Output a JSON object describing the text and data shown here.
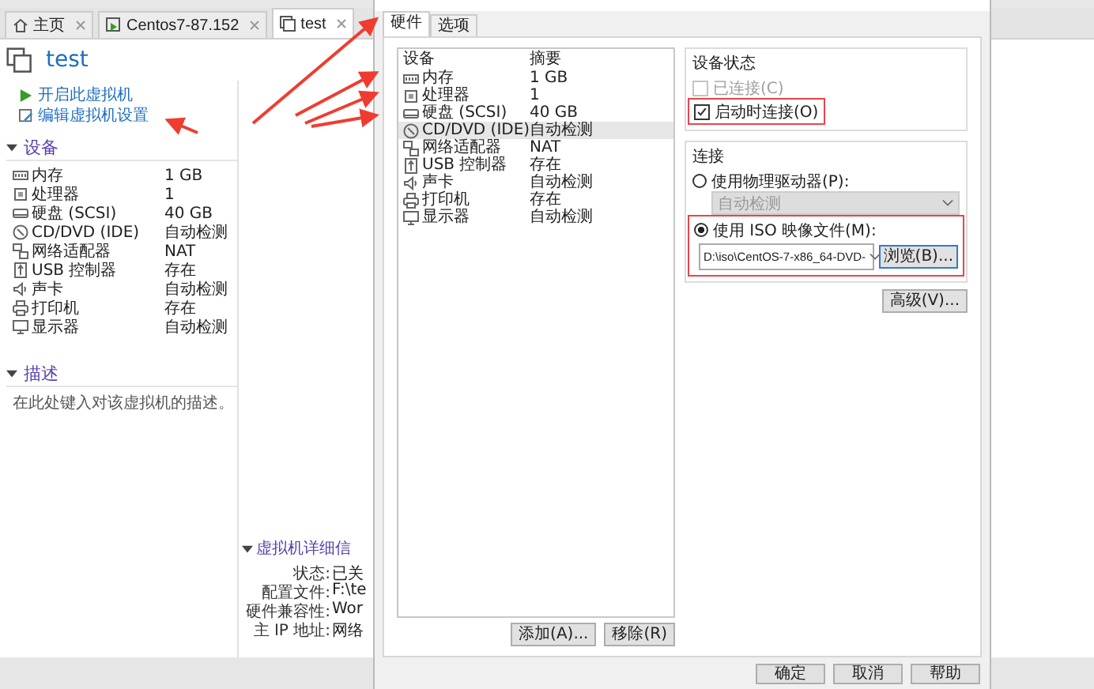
{
  "tabs": [
    {
      "label": "主页",
      "selected": false,
      "kind": "home"
    },
    {
      "label": "Centos7-87.152",
      "selected": false,
      "kind": "vm-running"
    },
    {
      "label": "test",
      "selected": true,
      "kind": "vm"
    }
  ],
  "vm": {
    "title": "test",
    "actions": [
      {
        "label": "开启此虚拟机",
        "kind": "play"
      },
      {
        "label": "编辑虚拟机设置",
        "kind": "edit"
      }
    ],
    "devices_heading": "设备",
    "devices": [
      {
        "name": "内存",
        "summary": "1 GB",
        "kind": "memory"
      },
      {
        "name": "处理器",
        "summary": "1",
        "kind": "cpu"
      },
      {
        "name": "硬盘 (SCSI)",
        "summary": "40 GB",
        "kind": "disk"
      },
      {
        "name": "CD/DVD (IDE)",
        "summary": "自动检测",
        "kind": "cd"
      },
      {
        "name": "网络适配器",
        "summary": "NAT",
        "kind": "network"
      },
      {
        "name": "USB 控制器",
        "summary": "存在",
        "kind": "usb"
      },
      {
        "name": "声卡",
        "summary": "自动检测",
        "kind": "sound"
      },
      {
        "name": "打印机",
        "summary": "存在",
        "kind": "printer"
      },
      {
        "name": "显示器",
        "summary": "自动检测",
        "kind": "display"
      }
    ],
    "description_heading": "描述",
    "description_placeholder": "在此处键入对该虚拟机的描述。",
    "details_heading": "虚拟机详细信",
    "details": [
      {
        "label": "状态:",
        "value": "已关"
      },
      {
        "label": "配置文件:",
        "value": "F:\\te"
      },
      {
        "label": "硬件兼容性:",
        "value": "Wor"
      },
      {
        "label": "主 IP 地址:",
        "value": "网络"
      }
    ]
  },
  "dialog": {
    "tabs": [
      {
        "label": "硬件",
        "selected": true
      },
      {
        "label": "选项",
        "selected": false
      }
    ],
    "columns": [
      "设备",
      "摘要"
    ],
    "devices": [
      {
        "name": "内存",
        "summary": "1 GB",
        "kind": "memory",
        "selected": false
      },
      {
        "name": "处理器",
        "summary": "1",
        "kind": "cpu",
        "selected": false
      },
      {
        "name": "硬盘 (SCSI)",
        "summary": "40 GB",
        "kind": "disk",
        "selected": false
      },
      {
        "name": "CD/DVD (IDE)",
        "summary": "自动检测",
        "kind": "cd",
        "selected": true
      },
      {
        "name": "网络适配器",
        "summary": "NAT",
        "kind": "network",
        "selected": false
      },
      {
        "name": "USB 控制器",
        "summary": "存在",
        "kind": "usb",
        "selected": false
      },
      {
        "name": "声卡",
        "summary": "自动检测",
        "kind": "sound",
        "selected": false
      },
      {
        "name": "打印机",
        "summary": "存在",
        "kind": "printer",
        "selected": false
      },
      {
        "name": "显示器",
        "summary": "自动检测",
        "kind": "display",
        "selected": false
      }
    ],
    "list_buttons": [
      "添加(A)...",
      "移除(R)"
    ],
    "device_status": {
      "heading": "设备状态",
      "checks": [
        {
          "label": "已连接(C)",
          "checked": false,
          "disabled": true,
          "highlighted": false
        },
        {
          "label": "启动时连接(O)",
          "checked": true,
          "disabled": false,
          "highlighted": true
        }
      ]
    },
    "connection": {
      "heading": "连接",
      "options": [
        {
          "label": "使用物理驱动器(P):",
          "selected": false,
          "kind": "select",
          "value": "自动检测",
          "highlighted": false
        },
        {
          "label": "使用 ISO 映像文件(M):",
          "selected": true,
          "kind": "file",
          "value": "D:\\iso\\CentOS-7-x86_64-DVD-",
          "button": "浏览(B)...",
          "highlighted": true
        }
      ]
    },
    "advanced_button": "高级(V)...",
    "buttons": [
      "确定",
      "取消",
      "帮助"
    ]
  }
}
